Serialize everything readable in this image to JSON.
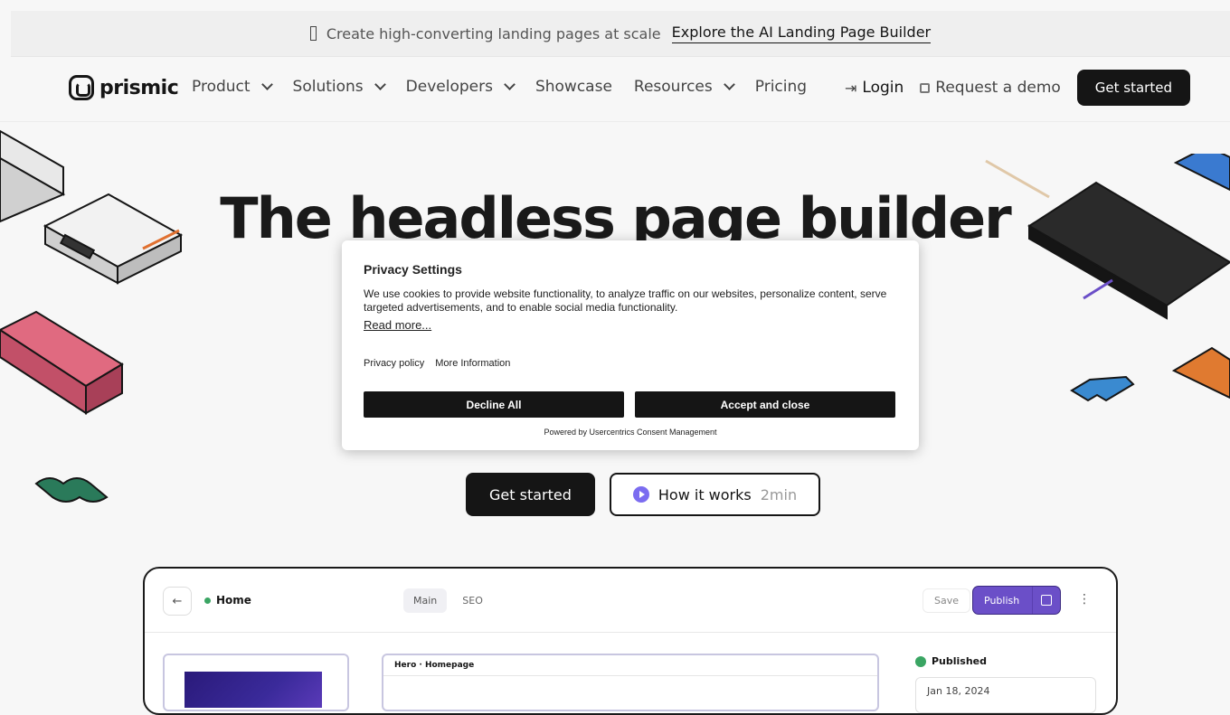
{
  "announcement": {
    "text": "Create high-converting landing pages at scale",
    "link": "Explore the AI Landing Page Builder"
  },
  "nav": {
    "logo": "prismic",
    "items": [
      {
        "label": "Product",
        "dropdown": true
      },
      {
        "label": "Solutions",
        "dropdown": true
      },
      {
        "label": "Developers",
        "dropdown": true
      },
      {
        "label": "Showcase",
        "dropdown": false
      },
      {
        "label": "Resources",
        "dropdown": true
      },
      {
        "label": "Pricing",
        "dropdown": false
      }
    ],
    "login": "Login",
    "demo": "Request a demo",
    "cta": "Get started"
  },
  "hero": {
    "title": "The headless page builder",
    "primary_button": "Get started",
    "secondary_button": "How it works",
    "secondary_duration": "2min"
  },
  "app_preview": {
    "back_icon": "←",
    "page_name": "Home",
    "tabs": [
      "Main",
      "SEO"
    ],
    "save": "Save",
    "publish": "Publish",
    "kebab": "⋮",
    "card_title": "Hero · Homepage",
    "status": "Published",
    "date": "Jan 18, 2024"
  },
  "cookie_dialog": {
    "title": "Privacy Settings",
    "description": "We use cookies to provide website functionality, to analyze traffic on our websites, personalize content, serve targeted advertisements, and to enable social media functionality.",
    "read_more": "Read more...",
    "privacy_policy": "Privacy policy",
    "more_information": "More Information",
    "decline": "Decline All",
    "accept": "Accept and close",
    "powered_by": "Powered by Usercentrics Consent Management"
  },
  "colors": {
    "accent": "#6b4fc8",
    "dark": "#151515",
    "status_green": "#3aa563"
  }
}
